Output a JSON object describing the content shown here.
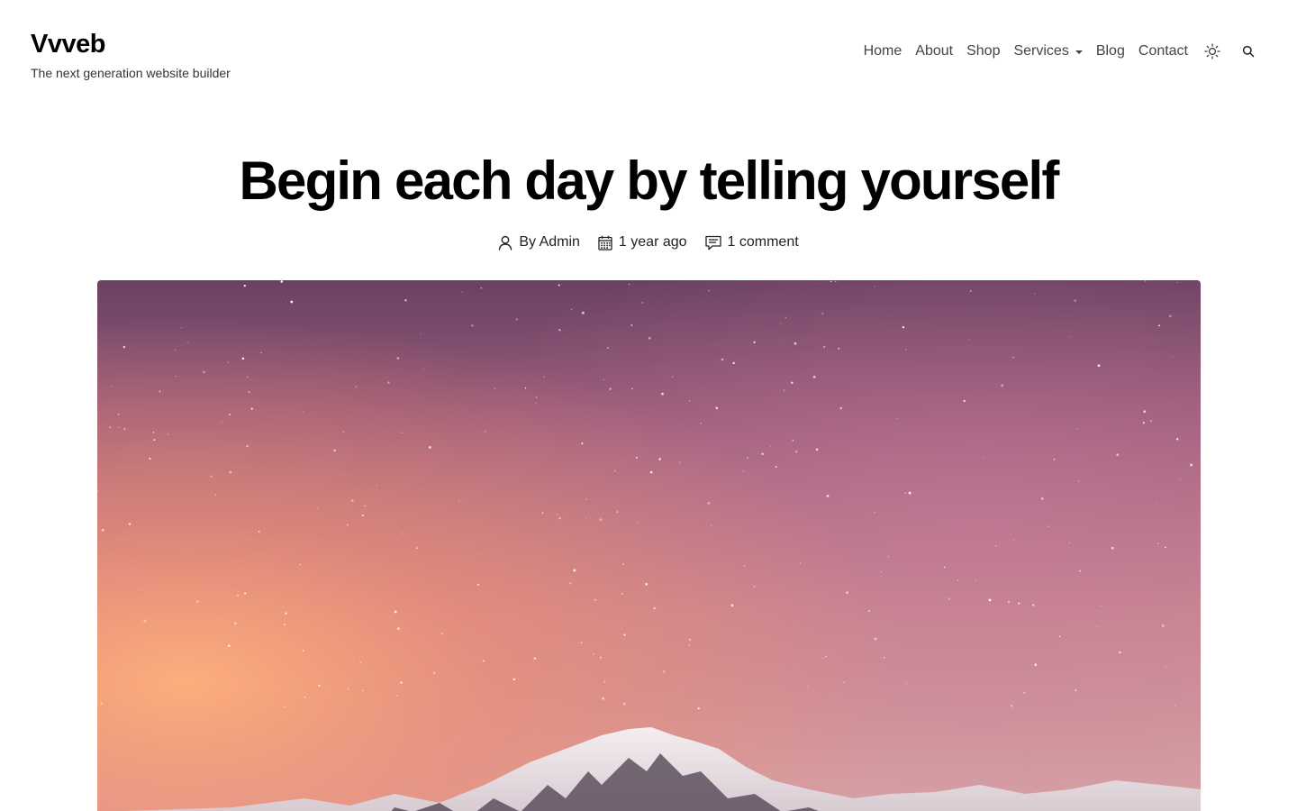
{
  "header": {
    "brand_title": "Vvveb",
    "tagline": "The next generation website builder"
  },
  "nav": {
    "items": [
      {
        "label": "Home"
      },
      {
        "label": "About"
      },
      {
        "label": "Shop"
      },
      {
        "label": "Services"
      },
      {
        "label": "Blog"
      },
      {
        "label": "Contact"
      }
    ],
    "theme_icon": "sun-icon",
    "search_icon": "search-icon"
  },
  "post": {
    "title": "Begin each day by telling yourself",
    "author": "By Admin",
    "date": "1 year ago",
    "comments": "1 comment"
  },
  "hero_image": {
    "subject": "snowy-mountain-starry-sky",
    "colors": [
      "#5f3c5e",
      "#c47a93",
      "#f3a172",
      "#e9b8a8"
    ]
  }
}
